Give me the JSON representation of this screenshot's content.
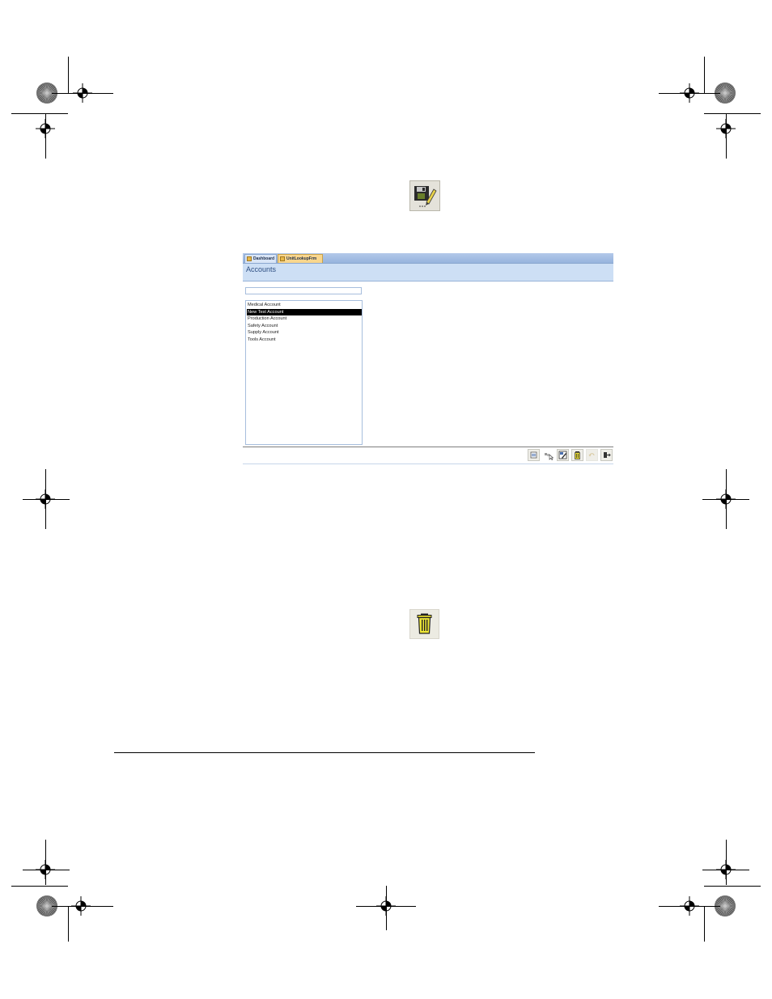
{
  "toolbar_icons": {
    "save_edit": "save-edit-icon",
    "delete": "trash-can-icon"
  },
  "form": {
    "tabs": [
      {
        "label": "Dashboard",
        "active": false
      },
      {
        "label": "UnitLookupFrm",
        "active": true
      }
    ],
    "title": "Accounts",
    "search_value": "",
    "accounts": [
      "Medical Account",
      "New Test Account",
      "Production Account",
      "Safety Account",
      "Supply Account",
      "Tools Account"
    ],
    "selected_index": 1,
    "footer_buttons": [
      "new-record-icon",
      "find-icon",
      "edit-record-icon",
      "delete-record-icon",
      "undo-icon",
      "exit-icon"
    ]
  },
  "colors": {
    "tab_strip": "#96b3de",
    "header_bg": "#cddff5",
    "title_text": "#2e4f83",
    "active_tab": "#f9d68d",
    "selection": "#000000"
  }
}
